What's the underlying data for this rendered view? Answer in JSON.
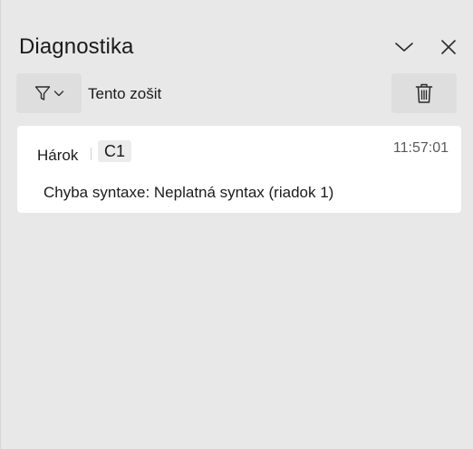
{
  "panel": {
    "title": "Diagnostika"
  },
  "toolbar": {
    "scope_label": "Tento zošit",
    "filter_icon": "filter-icon",
    "clear_icon": "trash-icon"
  },
  "entries": [
    {
      "sheet_label": "Hárok",
      "cell": "C1",
      "time": "11:57:01",
      "message": "Chyba syntaxe: Neplatná syntax (riadok 1)"
    }
  ],
  "colors": {
    "background": "#e8e8e8",
    "card": "#ffffff",
    "button": "#dedede"
  }
}
